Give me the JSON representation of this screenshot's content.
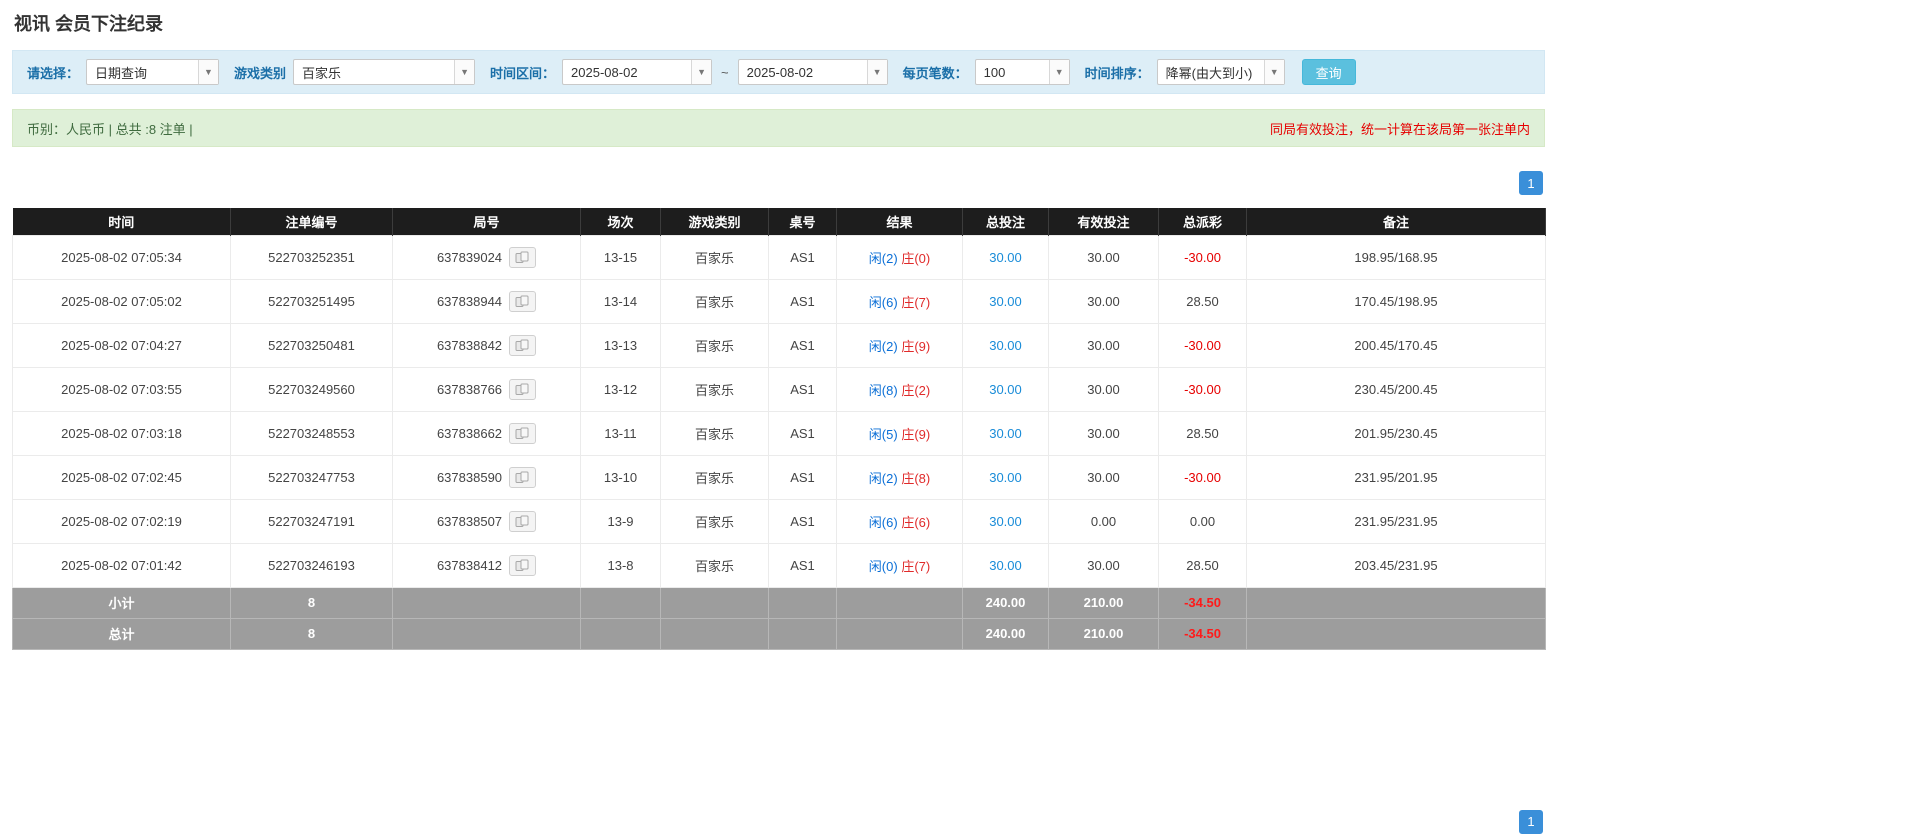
{
  "page": {
    "title": "视讯 会员下注纪录"
  },
  "filters": {
    "select_label": "请选择：",
    "select_value": "日期查询",
    "game_label": "游戏类别",
    "game_value": "百家乐",
    "range_label": "时间区间：",
    "date_from": "2025-08-02",
    "range_separator": "~",
    "date_to": "2025-08-02",
    "page_size_label": "每页笔数：",
    "page_size_value": "100",
    "sort_label": "时间排序：",
    "sort_value": "降幂(由大到小)",
    "search_label": "查询"
  },
  "summary": {
    "left": "币别：人民币 | 总共 :8 注单 |",
    "note": "同局有效投注，统一计算在该局第一张注单内"
  },
  "pagination": {
    "current_page": "1"
  },
  "table": {
    "headers": [
      "时间",
      "注单编号",
      "局号",
      "场次",
      "游戏类别",
      "桌号",
      "结果",
      "总投注",
      "有效投注",
      "总派彩",
      "备注"
    ],
    "rows": [
      {
        "time": "2025-08-02 07:05:34",
        "bet_id": "522703252351",
        "round_id": "637839024",
        "session": "13-15",
        "game": "百家乐",
        "table": "AS1",
        "player": "闲(2)",
        "banker": "庄(0)",
        "total_bet": "30.00",
        "valid_bet": "30.00",
        "payout": "-30.00",
        "note": "198.95/168.95"
      },
      {
        "time": "2025-08-02 07:05:02",
        "bet_id": "522703251495",
        "round_id": "637838944",
        "session": "13-14",
        "game": "百家乐",
        "table": "AS1",
        "player": "闲(6)",
        "banker": "庄(7)",
        "total_bet": "30.00",
        "valid_bet": "30.00",
        "payout": "28.50",
        "note": "170.45/198.95"
      },
      {
        "time": "2025-08-02 07:04:27",
        "bet_id": "522703250481",
        "round_id": "637838842",
        "session": "13-13",
        "game": "百家乐",
        "table": "AS1",
        "player": "闲(2)",
        "banker": "庄(9)",
        "total_bet": "30.00",
        "valid_bet": "30.00",
        "payout": "-30.00",
        "note": "200.45/170.45"
      },
      {
        "time": "2025-08-02 07:03:55",
        "bet_id": "522703249560",
        "round_id": "637838766",
        "session": "13-12",
        "game": "百家乐",
        "table": "AS1",
        "player": "闲(8)",
        "banker": "庄(2)",
        "total_bet": "30.00",
        "valid_bet": "30.00",
        "payout": "-30.00",
        "note": "230.45/200.45"
      },
      {
        "time": "2025-08-02 07:03:18",
        "bet_id": "522703248553",
        "round_id": "637838662",
        "session": "13-11",
        "game": "百家乐",
        "table": "AS1",
        "player": "闲(5)",
        "banker": "庄(9)",
        "total_bet": "30.00",
        "valid_bet": "30.00",
        "payout": "28.50",
        "note": "201.95/230.45"
      },
      {
        "time": "2025-08-02 07:02:45",
        "bet_id": "522703247753",
        "round_id": "637838590",
        "session": "13-10",
        "game": "百家乐",
        "table": "AS1",
        "player": "闲(2)",
        "banker": "庄(8)",
        "total_bet": "30.00",
        "valid_bet": "30.00",
        "payout": "-30.00",
        "note": "231.95/201.95"
      },
      {
        "time": "2025-08-02 07:02:19",
        "bet_id": "522703247191",
        "round_id": "637838507",
        "session": "13-9",
        "game": "百家乐",
        "table": "AS1",
        "player": "闲(6)",
        "banker": "庄(6)",
        "total_bet": "30.00",
        "valid_bet": "0.00",
        "payout": "0.00",
        "note": "231.95/231.95"
      },
      {
        "time": "2025-08-02 07:01:42",
        "bet_id": "522703246193",
        "round_id": "637838412",
        "session": "13-8",
        "game": "百家乐",
        "table": "AS1",
        "player": "闲(0)",
        "banker": "庄(7)",
        "total_bet": "30.00",
        "valid_bet": "30.00",
        "payout": "28.50",
        "note": "203.45/231.95"
      }
    ],
    "subtotal": {
      "label": "小计",
      "count": "8",
      "total_bet": "240.00",
      "valid_bet": "210.00",
      "payout": "-34.50"
    },
    "total": {
      "label": "总计",
      "count": "8",
      "total_bet": "240.00",
      "valid_bet": "210.00",
      "payout": "-34.50"
    }
  },
  "icons": {
    "combo_arrow": "▼",
    "cards_icon": "cards-icon"
  },
  "colors": {
    "header_bg": "#1d1d1d",
    "footer_bg": "#9d9d9d",
    "accent_blue": "#1a8cd8",
    "player_blue": "#0b6fd6",
    "banker_red": "#e02b2b",
    "negative_red": "#e60000",
    "filter_bg": "#ddeef7",
    "summary_bg": "#dff0d8",
    "search_btn_bg": "#5bc0de",
    "pager_btn_bg": "#3a8fd9"
  }
}
